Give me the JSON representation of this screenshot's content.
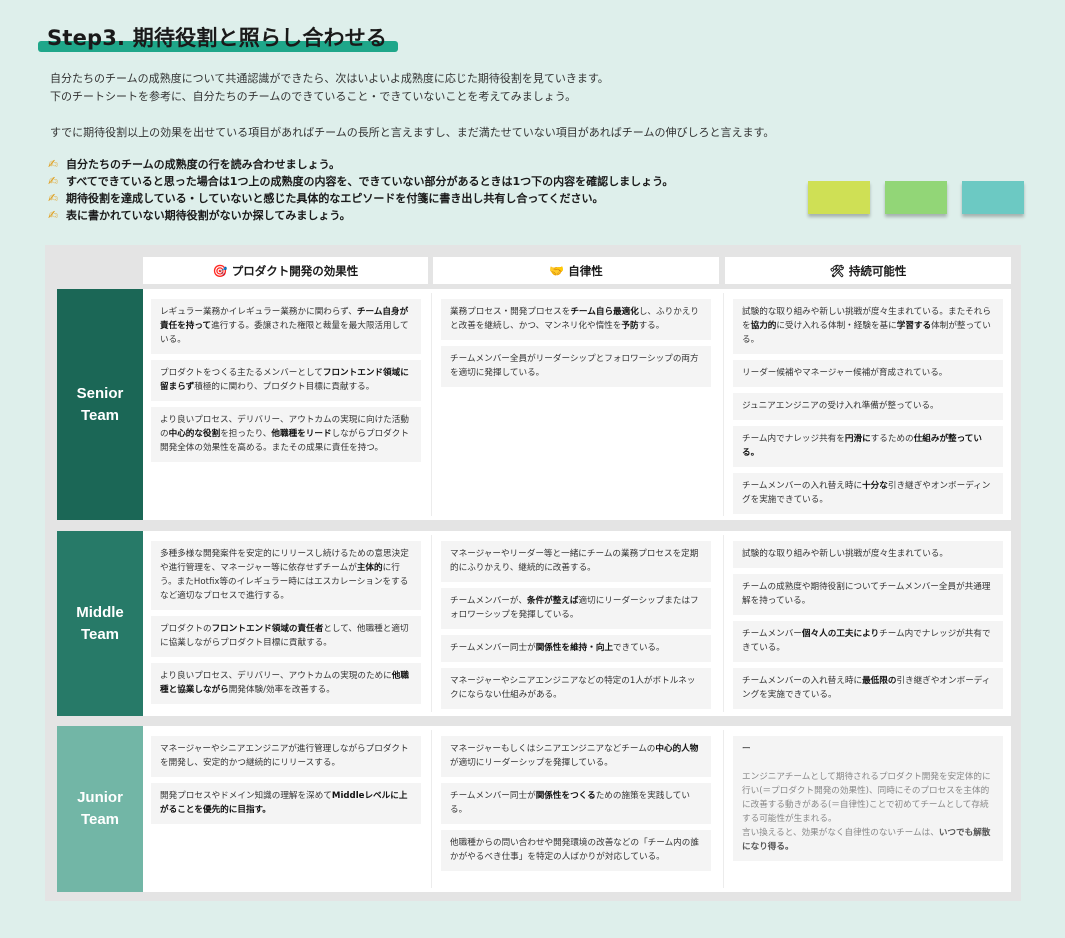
{
  "header": {
    "title": "Step3. 期待役割と照らし合わせる",
    "accent_color": "#1fa78a"
  },
  "intro": {
    "lines": [
      "自分たちのチームの成熟度について共通認識ができたら、次はいよいよ成熟度に応じた期待役割を見ていきます。",
      "下のチートシートを参考に、自分たちのチームのできていること・できていないことを考えてみましょう。",
      "すでに期待役割以上の効果を出せている項目があればチームの長所と言えますし、まだ満たせていない項目があればチームの伸びしろと言えます。"
    ]
  },
  "steps": {
    "icon": "writing-hand-icon",
    "items": [
      "自分たちのチームの成熟度の行を読み合わせましょう。",
      "すべてできていると思った場合は1つ上の成熟度の内容を、できていない部分があるときは1つ下の内容を確認しましょう。",
      "期待役割を達成している・していないと感じた具体的なエピソードを付箋に書き出し共有し合ってください。",
      "表に書かれていない期待役割がないか探してみましょう。"
    ]
  },
  "stickies": [
    {
      "color": "#cfe055"
    },
    {
      "color": "#92d677"
    },
    {
      "color": "#6cc9c3"
    }
  ],
  "table": {
    "columns": [
      {
        "icon": "target-icon",
        "glyph": "🎯",
        "label": "プロダクト開発の効果性"
      },
      {
        "icon": "handshake-icon",
        "glyph": "🤝",
        "label": "自律性"
      },
      {
        "icon": "tools-icon",
        "glyph": "🛠",
        "label": "持続可能性"
      }
    ],
    "rows": [
      {
        "label_line1": "Senior",
        "label_line2": "Team",
        "color": "#1b6756",
        "cells": [
          [
            "レギュラー業務かイレギュラー業務かに関わらず、<b>チーム自身が責任を持って</b>進行する。委譲された権限と裁量を最大限活用している。",
            "プロダクトをつくる主たるメンバーとして<b>フロントエンド領域に留まらず</b>積極的に関わり、プロダクト目標に貢献する。",
            "より良いプロセス、デリバリー、アウトカムの実現に向けた活動の<b>中心的な役割</b>を担ったり、<b>他職種をリード</b>しながらプロダクト開発全体の効果性を高める。またその成果に責任を持つ。"
          ],
          [
            "業務プロセス・開発プロセスを<b>チーム自ら最適化</b>し、ふりかえりと改善を継続し、かつ、マンネリ化や惰性を<b>予防</b>する。",
            "チームメンバー全員がリーダーシップとフォロワーシップの両方を適切に発揮している。"
          ],
          [
            "試験的な取り組みや新しい挑戦が度々生まれている。またそれらを<b>協力的</b>に受け入れる体制・経験を基に<b>学習する</b>体制が整っている。",
            "リーダー候補やマネージャー候補が育成されている。",
            "ジュニアエンジニアの受け入れ準備が整っている。",
            "チーム内でナレッジ共有を<b>円滑に</b>するための<b>仕組みが整っている。</b>",
            "チームメンバーの入れ替え時に<b>十分な</b>引き継ぎやオンボーディングを実施できている。"
          ]
        ]
      },
      {
        "label_line1": "Middle",
        "label_line2": "Team",
        "color": "#277a68",
        "cells": [
          [
            "多種多様な開発案件を安定的にリリースし続けるための意思決定や進行管理を、マネージャー等に依存せずチームが<b>主体的</b>に行う。またHotfix等のイレギュラー時にはエスカレーションをするなど適切なプロセスで進行する。",
            "プロダクトの<b>フロントエンド領域の責任者</b>として、他職種と適切に協業しながらプロダクト目標に貢献する。",
            "より良いプロセス、デリバリー、アウトカムの実現のために<b>他職種と協業しながら</b>開発体験/効率を改善する。"
          ],
          [
            "マネージャーやリーダー等と一緒にチームの業務プロセスを定期的にふりかえり、継続的に改善する。",
            "チームメンバーが、<b>条件が整えば</b>適切にリーダーシップまたはフォロワーシップを発揮している。",
            "チームメンバー同士が<b>関係性を維持・向上</b>できている。",
            "マネージャーやシニアエンジニアなどの特定の1人がボトルネックにならない仕組みがある。"
          ],
          [
            "試験的な取り組みや新しい挑戦が度々生まれている。",
            "チームの成熟度や期待役割についてチームメンバー全員が共通理解を持っている。",
            "チームメンバー<b>個々人の工夫により</b>チーム内でナレッジが共有できている。",
            "チームメンバーの入れ替え時に<b>最低限の</b>引き継ぎやオンボーディングを実施できている。"
          ]
        ]
      },
      {
        "label_line1": "Junior",
        "label_line2": "Team",
        "color": "#72b6a6",
        "cells": [
          [
            "マネージャーやシニアエンジニアが進行管理しながらプロダクトを開発し、安定的かつ継続的にリリースする。",
            "開発プロセスやドメイン知識の理解を深めて<b>Middleレベルに上がることを優先的に目指す。</b>"
          ],
          [
            "マネージャーもしくはシニアエンジニアなどチームの<b>中心的人物</b>が適切にリーダーシップを発揮している。",
            "チームメンバー同士が<b>関係性をつくる</b>ための施策を実践している。",
            "他職種からの問い合わせや開発環境の改善などの「チーム内の誰かがやるべき仕事」を特定の人ばかりが対応している。"
          ],
          [
            "<b>ー</b><br><br>エンジニアチームとして期待されるプロダクト開発を安定体的に行い(＝プロダクト開発の効果性)、同時にそのプロセスを主体的に改善する動きがある(＝自律性)ことで初めてチームとして存続する可能性が生まれる。<br>言い換えると、効果がなく自律性のないチームは、<b>いつでも解散になり得る。</b>"
          ]
        ]
      }
    ]
  }
}
